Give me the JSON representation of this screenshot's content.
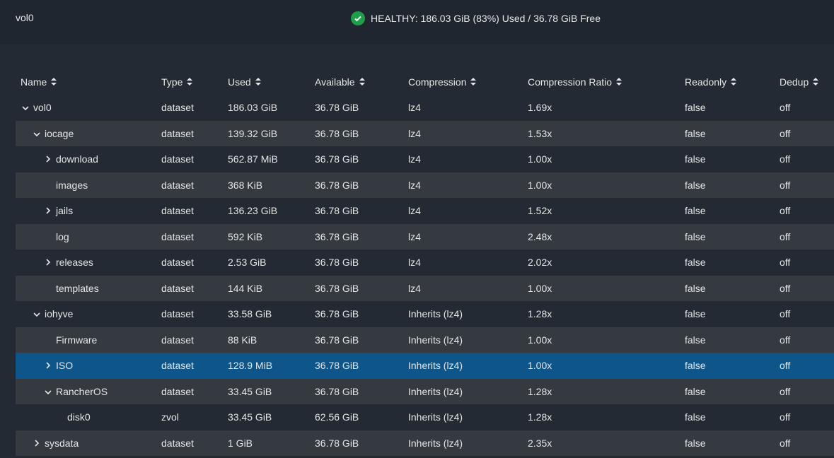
{
  "header": {
    "volume": "vol0",
    "status": "HEALTHY: 186.03 GiB (83%) Used / 36.78 GiB Free",
    "status_color": "#1e9e48"
  },
  "columns": [
    "Name",
    "Type",
    "Used",
    "Available",
    "Compression",
    "Compression Ratio",
    "Readonly",
    "Dedup"
  ],
  "rows": [
    {
      "name": "vol0",
      "depth": 0,
      "toggle": "expanded",
      "type": "dataset",
      "used": "186.03 GiB",
      "available": "36.78 GiB",
      "compression": "lz4",
      "ratio": "1.69x",
      "readonly": "false",
      "dedup": "off"
    },
    {
      "name": "iocage",
      "depth": 1,
      "toggle": "expanded",
      "type": "dataset",
      "used": "139.32 GiB",
      "available": "36.78 GiB",
      "compression": "lz4",
      "ratio": "1.53x",
      "readonly": "false",
      "dedup": "off"
    },
    {
      "name": "download",
      "depth": 2,
      "toggle": "collapsed",
      "type": "dataset",
      "used": "562.87 MiB",
      "available": "36.78 GiB",
      "compression": "lz4",
      "ratio": "1.00x",
      "readonly": "false",
      "dedup": "off"
    },
    {
      "name": "images",
      "depth": 2,
      "toggle": "none",
      "type": "dataset",
      "used": "368 KiB",
      "available": "36.78 GiB",
      "compression": "lz4",
      "ratio": "1.00x",
      "readonly": "false",
      "dedup": "off"
    },
    {
      "name": "jails",
      "depth": 2,
      "toggle": "collapsed",
      "type": "dataset",
      "used": "136.23 GiB",
      "available": "36.78 GiB",
      "compression": "lz4",
      "ratio": "1.52x",
      "readonly": "false",
      "dedup": "off"
    },
    {
      "name": "log",
      "depth": 2,
      "toggle": "none",
      "type": "dataset",
      "used": "592 KiB",
      "available": "36.78 GiB",
      "compression": "lz4",
      "ratio": "2.48x",
      "readonly": "false",
      "dedup": "off"
    },
    {
      "name": "releases",
      "depth": 2,
      "toggle": "collapsed",
      "type": "dataset",
      "used": "2.53 GiB",
      "available": "36.78 GiB",
      "compression": "lz4",
      "ratio": "2.02x",
      "readonly": "false",
      "dedup": "off"
    },
    {
      "name": "templates",
      "depth": 2,
      "toggle": "none",
      "type": "dataset",
      "used": "144 KiB",
      "available": "36.78 GiB",
      "compression": "lz4",
      "ratio": "1.00x",
      "readonly": "false",
      "dedup": "off"
    },
    {
      "name": "iohyve",
      "depth": 1,
      "toggle": "expanded",
      "type": "dataset",
      "used": "33.58 GiB",
      "available": "36.78 GiB",
      "compression": "Inherits (lz4)",
      "ratio": "1.28x",
      "readonly": "false",
      "dedup": "off"
    },
    {
      "name": "Firmware",
      "depth": 2,
      "toggle": "none",
      "type": "dataset",
      "used": "88 KiB",
      "available": "36.78 GiB",
      "compression": "Inherits (lz4)",
      "ratio": "1.00x",
      "readonly": "false",
      "dedup": "off"
    },
    {
      "name": "ISO",
      "depth": 2,
      "toggle": "collapsed",
      "selected": true,
      "type": "dataset",
      "used": "128.9 MiB",
      "available": "36.78 GiB",
      "compression": "Inherits (lz4)",
      "ratio": "1.00x",
      "readonly": "false",
      "dedup": "off"
    },
    {
      "name": "RancherOS",
      "depth": 2,
      "toggle": "expanded",
      "type": "dataset",
      "used": "33.45 GiB",
      "available": "36.78 GiB",
      "compression": "Inherits (lz4)",
      "ratio": "1.28x",
      "readonly": "false",
      "dedup": "off"
    },
    {
      "name": "disk0",
      "depth": 3,
      "toggle": "none",
      "type": "zvol",
      "used": "33.45 GiB",
      "available": "62.56 GiB",
      "compression": "Inherits (lz4)",
      "ratio": "1.28x",
      "readonly": "false",
      "dedup": "off"
    },
    {
      "name": "sysdata",
      "depth": 1,
      "toggle": "collapsed",
      "type": "dataset",
      "used": "1 GiB",
      "available": "36.78 GiB",
      "compression": "Inherits (lz4)",
      "ratio": "2.35x",
      "readonly": "false",
      "dedup": "off"
    }
  ]
}
